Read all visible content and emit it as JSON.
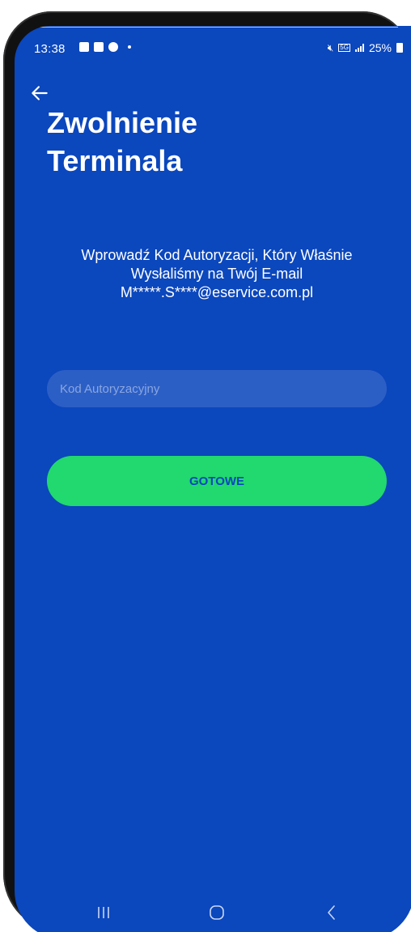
{
  "status_bar": {
    "time": "13:38",
    "battery": "25%",
    "network": "5G"
  },
  "header": {
    "title_line1": "Zwolnienie",
    "title_line2": "Terminala"
  },
  "instruction": {
    "line1": "Wprowadź Kod Autoryzacji, Który Właśnie",
    "line2": "Wysłaliśmy na Twój E-mail",
    "line3": "M*****.S****@eservice.com.pl"
  },
  "auth_field": {
    "placeholder": "Kod Autoryzacyjny",
    "value": ""
  },
  "done_button": {
    "label": "GOTOWE"
  },
  "colors": {
    "background": "#0b47bd",
    "button": "#21d96e",
    "input": "#2c5fc6"
  },
  "icons": {
    "back": "arrow-left-icon",
    "nav_recent": "recent-apps-icon",
    "nav_home": "home-icon",
    "nav_back": "chevron-left-icon"
  }
}
